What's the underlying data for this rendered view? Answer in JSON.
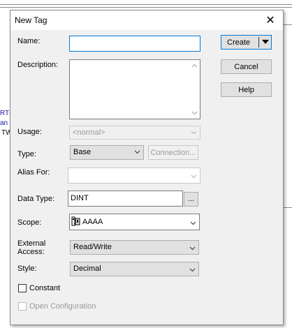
{
  "window": {
    "title": "New Tag",
    "close_glyph": "✕"
  },
  "background": {
    "text_1": "RT–",
    "text_2": "an",
    "text_3": "TW"
  },
  "fields": {
    "name_label": "Name:",
    "name_value": "",
    "description_label": "Description:",
    "description_value": "",
    "usage_label": "Usage:",
    "usage_value": "<normal>",
    "type_label": "Type:",
    "type_value": "Base",
    "alias_label": "Alias For:",
    "alias_value": "",
    "data_type_label": "Data Type:",
    "data_type_value": "DINT",
    "browse_label": "...",
    "scope_label": "Scope:",
    "scope_value": "AAAA",
    "external_access_label_1": "External",
    "external_access_label_2": "Access:",
    "external_access_value": "Read/Write",
    "style_label": "Style:",
    "style_value": "Decimal",
    "constant_label": "Constant",
    "open_configuration_label": "Open Configuration"
  },
  "buttons": {
    "create": "Create",
    "cancel": "Cancel",
    "help": "Help",
    "connection": "Connection..."
  },
  "icons": {
    "close": "close-icon",
    "dropdown": "chevron-down-icon",
    "scope": "controller-icon",
    "scroll_up": "scroll-up-icon",
    "scroll_down": "scroll-down-icon"
  },
  "colors": {
    "focus_border": "#0078d7",
    "background_link": "#1a1aa6"
  }
}
